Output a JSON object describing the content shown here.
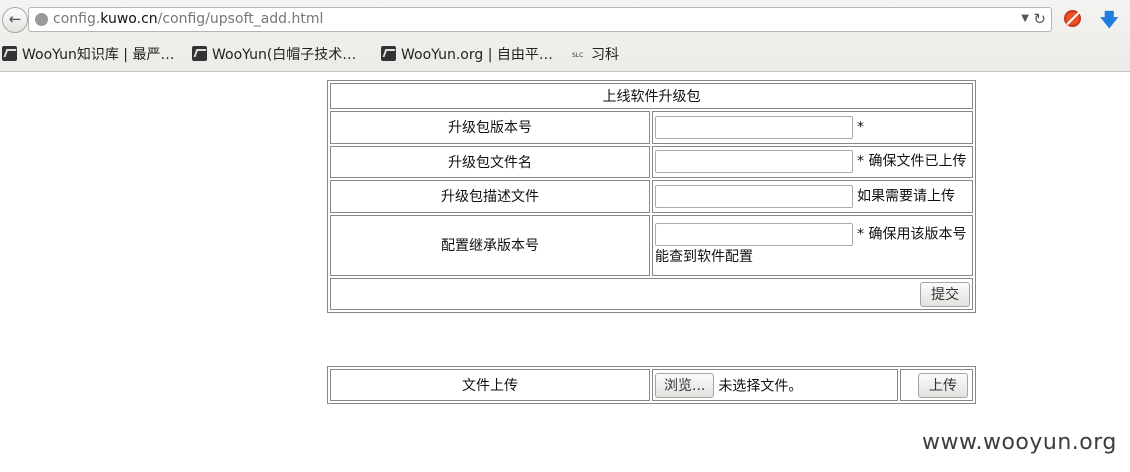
{
  "browser": {
    "url_prefix": "config.",
    "url_host": "kuwo.cn",
    "url_path": "/config/upsoft_add.html",
    "bookmarks": [
      {
        "label": "WooYun知识库 | 最严…"
      },
      {
        "label": "WooYun(白帽子技术…"
      },
      {
        "label": "WooYun.org | 自由平…"
      },
      {
        "label": "习科"
      }
    ]
  },
  "form": {
    "title": "上线软件升级包",
    "rows": [
      {
        "label": "升级包版本号",
        "value": "",
        "hint": "*"
      },
      {
        "label": "升级包文件名",
        "value": "",
        "hint": "* 确保文件已上传"
      },
      {
        "label": "升级包描述文件",
        "value": "",
        "hint": "如果需要请上传"
      },
      {
        "label": "配置继承版本号",
        "value": "",
        "hint": "* 确保用该版本号能查到软件配置"
      }
    ],
    "submit_label": "提交"
  },
  "upload": {
    "label": "文件上传",
    "browse_label": "浏览...",
    "file_status": "未选择文件。",
    "upload_label": "上传"
  },
  "watermark": "www.wooyun.org"
}
